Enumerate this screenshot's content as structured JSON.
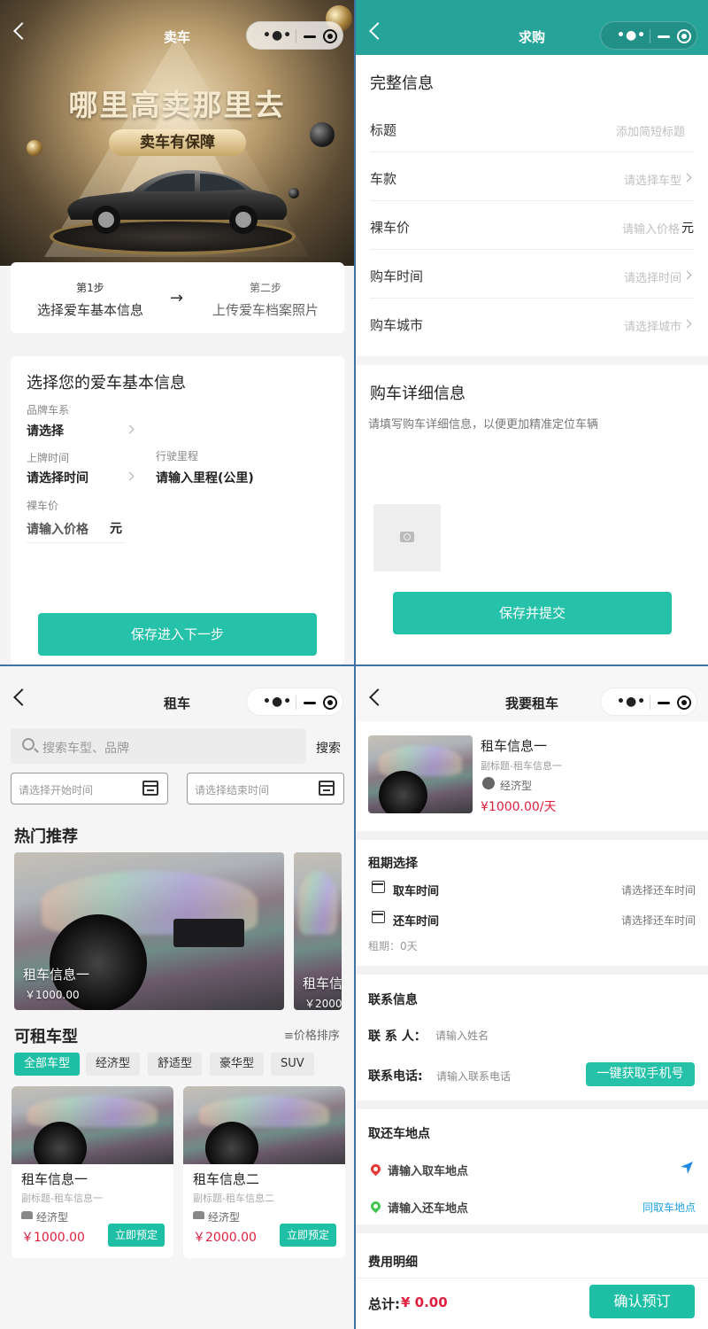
{
  "sell": {
    "nav_title": "卖车",
    "hero_title": "哪里高卖那里去",
    "hero_badge": "卖车有保障",
    "step1_no": "第1步",
    "step1_label": "选择爱车基本信息",
    "step2_no": "第二步",
    "step2_label": "上传爱车档案照片",
    "form_title": "选择您的爱车基本信息",
    "brand_label": "品牌车系",
    "brand_value": "请选择",
    "reg_label": "上牌时间",
    "reg_value": "请选择时间",
    "mileage_label": "行驶里程",
    "mileage_value": "请输入里程(公里)",
    "price_label": "裸车价",
    "price_value": "请输入价格",
    "price_unit": "元",
    "submit": "保存进入下一步"
  },
  "buy": {
    "nav_title": "求购",
    "section1": "完整信息",
    "rows": [
      {
        "label": "标题",
        "value": "添加简短标题"
      },
      {
        "label": "车款",
        "value": "请选择车型"
      },
      {
        "label": "裸车价",
        "value": "请输入价格",
        "unit": "元"
      },
      {
        "label": "购车时间",
        "value": "请选择时间"
      },
      {
        "label": "购车城市",
        "value": "请选择城市"
      }
    ],
    "section2": "购车详细信息",
    "detail_placeholder": "请填写购车详细信息，以便更加精准定位车辆",
    "submit": "保存并提交"
  },
  "rent": {
    "nav_title": "租车",
    "search_placeholder": "搜索车型、品牌",
    "search_button": "搜索",
    "start_placeholder": "请选择开始时间",
    "end_placeholder": "请选择结束时间",
    "hot_title": "热门推荐",
    "hot": [
      {
        "name": "租车信息一",
        "price": "￥1000.00"
      },
      {
        "name": "租车信",
        "price": "￥2000"
      }
    ],
    "list_title": "可租车型",
    "sort": "价格排序",
    "tabs": [
      "全部车型",
      "经济型",
      "舒适型",
      "豪华型",
      "SUV"
    ],
    "cars": [
      {
        "name": "租车信息一",
        "sub": "副标题-租车信息一",
        "type": "经济型",
        "price": "￥1000.00",
        "book": "立即预定"
      },
      {
        "name": "租车信息二",
        "sub": "副标题-租车信息二",
        "type": "经济型",
        "price": "￥2000.00",
        "book": "立即预定"
      }
    ]
  },
  "order": {
    "nav_title": "我要租车",
    "car_name": "租车信息一",
    "car_sub": "副标题-租车信息一",
    "car_type": "经济型",
    "car_price": "¥1000.00/天",
    "period_title": "租期选择",
    "pick_label": "取车时间",
    "pick_value": "请选择还车时间",
    "return_label": "还车时间",
    "return_value": "请选择还车时间",
    "days": "租期：0天",
    "contact_title": "联系信息",
    "name_label": "联 系 人：",
    "name_placeholder": "请输入姓名",
    "phone_label": "联系电话:",
    "phone_placeholder": "请输入联系电话",
    "phone_button": "一键获取手机号",
    "place_title": "取还车地点",
    "pick_place": "请输入取车地点",
    "return_place": "请输入还车地点",
    "same_place": "同取车地点",
    "fee_title": "费用明细",
    "total_label": "总计:",
    "total_value": "¥ 0.00",
    "confirm": "确认预订"
  },
  "colors": {
    "teal": "#26c1a9",
    "price_red": "#e0203f",
    "nav_teal": "#26a49a"
  }
}
